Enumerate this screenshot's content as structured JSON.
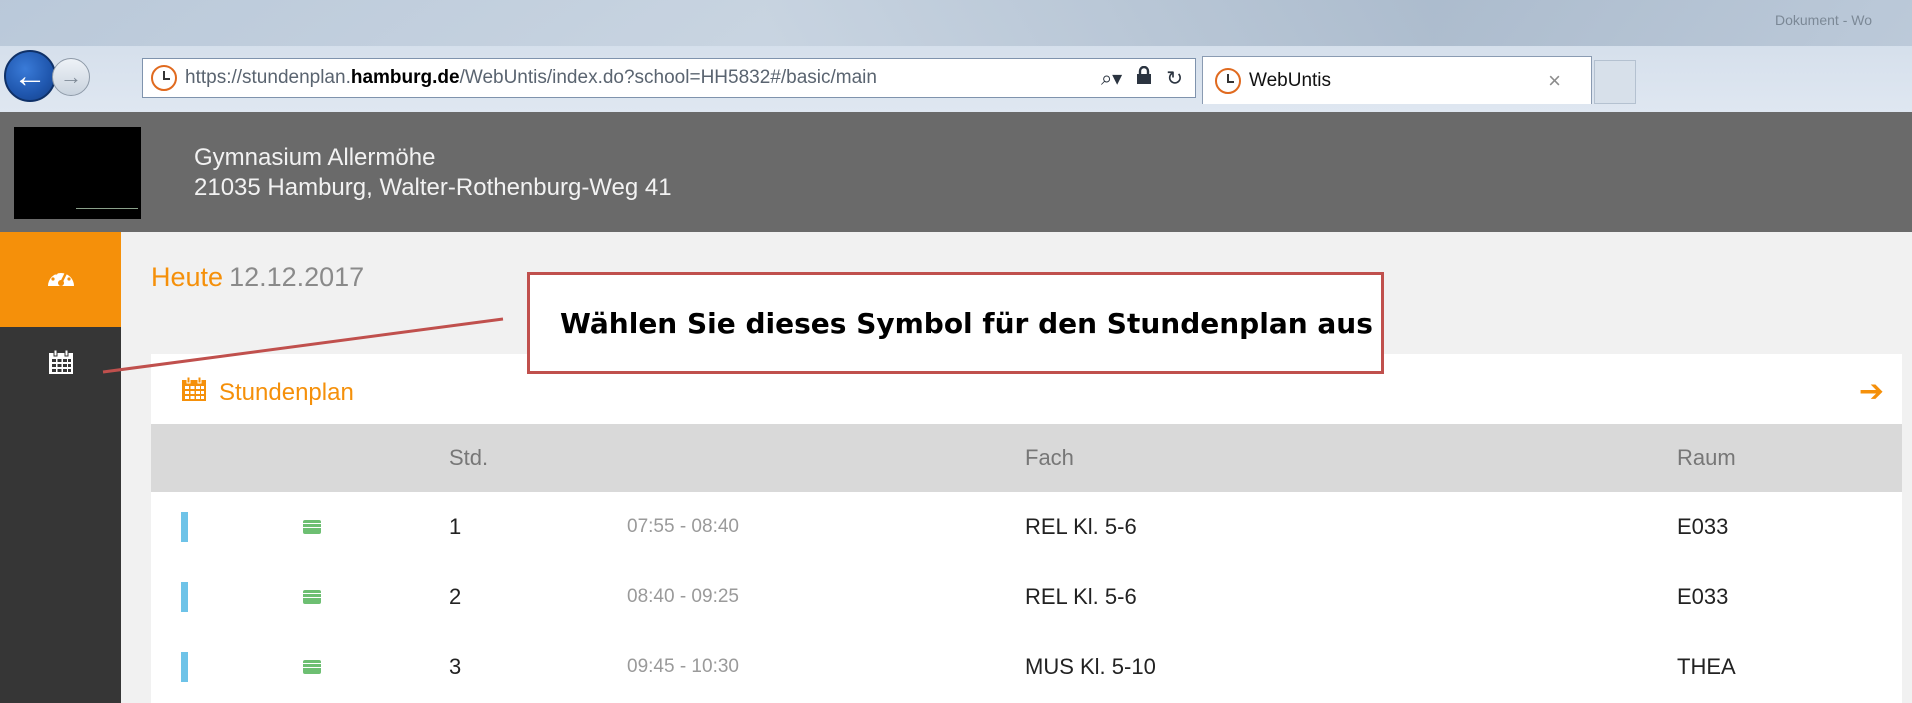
{
  "browser": {
    "window_title": "Dokument - Wo",
    "url_scheme": "https://stundenplan.",
    "url_host": "hamburg.de",
    "url_path": "/WebUntis/index.do?school=HH5832#/basic/main",
    "tab_title": "WebUntis",
    "tab_close": "×",
    "icons": [
      "back-arrow-icon",
      "forward-arrow-icon",
      "clock-icon",
      "search-icon",
      "lock-icon",
      "refresh-icon",
      "close-icon"
    ]
  },
  "header": {
    "school_name": "Gymnasium Allermöhe",
    "school_address": "21035 Hamburg, Walter-Rothenburg-Weg 41"
  },
  "sidebar": {
    "items": [
      {
        "name": "dashboard",
        "icon": "dashboard-icon",
        "active": true
      },
      {
        "name": "calendar",
        "icon": "calendar-icon",
        "active": false
      }
    ]
  },
  "main": {
    "today_label": "Heute",
    "today_date": "12.12.2017",
    "card": {
      "title": "Stundenplan",
      "columns": {
        "std": "Std.",
        "fach": "Fach",
        "raum": "Raum"
      },
      "rows": [
        {
          "std": "1",
          "time": "07:55 - 08:40",
          "fach": "REL Kl. 5-6",
          "raum": "E033"
        },
        {
          "std": "2",
          "time": "08:40 - 09:25",
          "fach": "REL Kl. 5-6",
          "raum": "E033"
        },
        {
          "std": "3",
          "time": "09:45 - 10:30",
          "fach": "MUS Kl. 5-10",
          "raum": "THEA"
        }
      ]
    }
  },
  "annotation": {
    "text": "Wählen Sie dieses Symbol für den Stundenplan aus"
  },
  "colors": {
    "accent": "#f5900a",
    "header_bg": "#6a6a6a",
    "sidebar_bg": "#363636",
    "callout_border": "#c0504d",
    "lesson_bar": "#6ec3e8",
    "lesson_icon": "#6dbf72"
  }
}
